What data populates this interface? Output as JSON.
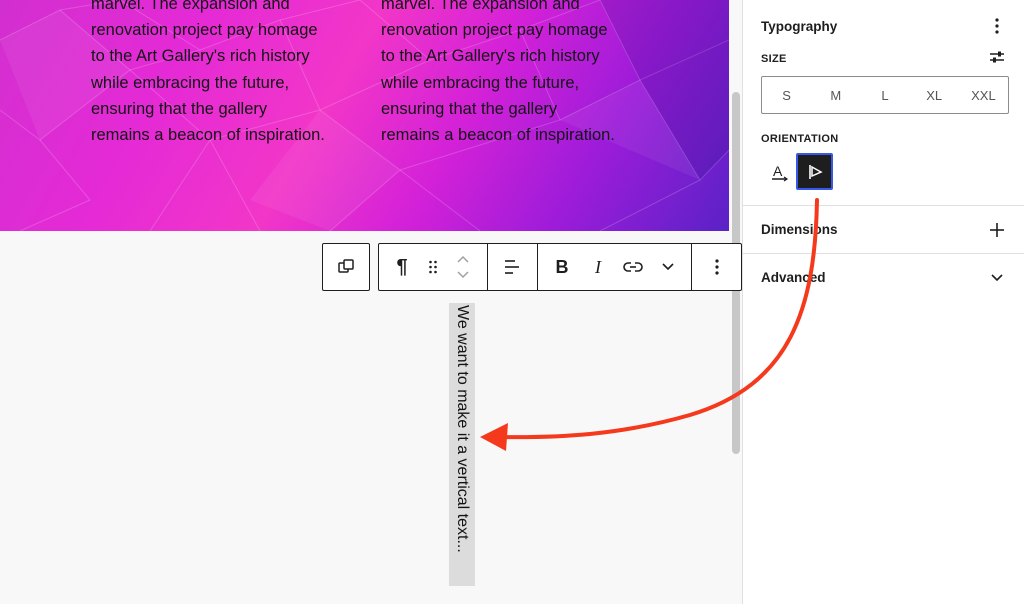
{
  "canvas": {
    "columns": [
      {
        "lines": [
          "marvel. The expansion and",
          "renovation project pay homage",
          "to the Art Gallery's rich history",
          "while embracing the future,",
          "ensuring that the gallery",
          "remains a beacon of inspiration."
        ]
      },
      {
        "lines": [
          "marvel. The expansion and",
          "renovation project pay homage",
          "to the Art Gallery's rich history",
          "while embracing the future,",
          "ensuring that the gallery",
          "remains a beacon of inspiration."
        ]
      }
    ],
    "vertical_text": "We want to make it a vertical text..."
  },
  "toolbar": {
    "block_type_icon": "copy-blocks-icon",
    "paragraph_symbol": "¶",
    "drag_icon": "drag-handle-icon",
    "move_icon": "chevron-up-down-icon",
    "align_icon": "align-left-icon",
    "bold_label": "B",
    "italic_label": "I",
    "link_icon": "link-icon",
    "more_icon": "chevron-down-icon",
    "options_icon": "more-vertical-icon"
  },
  "sidebar": {
    "typography": {
      "title": "Typography",
      "size_label": "SIZE",
      "sizes": [
        "S",
        "M",
        "L",
        "XL",
        "XXL"
      ],
      "orientation_label": "ORIENTATION",
      "orientation_options": [
        "horizontal-text-icon",
        "vertical-text-icon"
      ],
      "selected_orientation": "vertical-text-icon"
    },
    "dimensions": {
      "title": "Dimensions"
    },
    "advanced": {
      "title": "Advanced"
    }
  },
  "colors": {
    "annotation_arrow": "#f5391c",
    "selected_bg": "#1e1e1e",
    "selected_ring": "#3858e9"
  }
}
